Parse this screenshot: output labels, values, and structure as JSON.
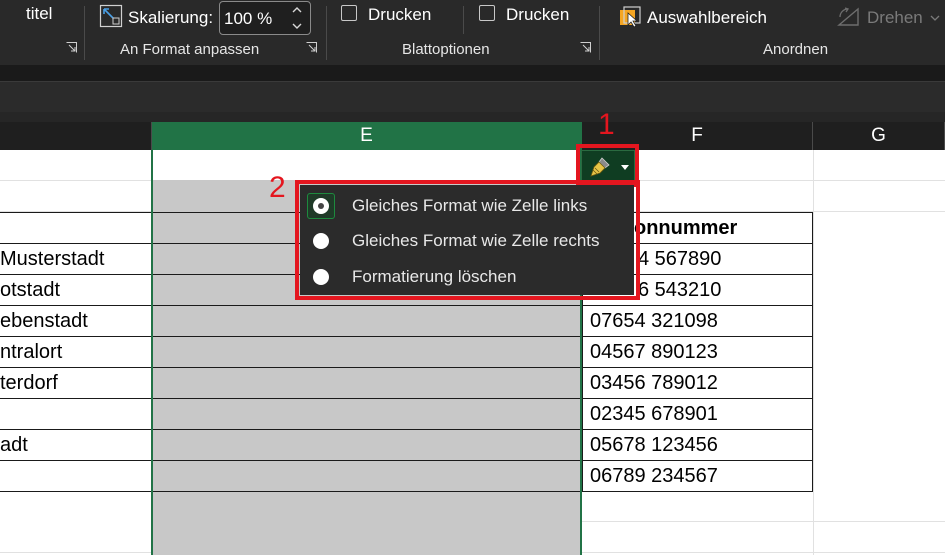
{
  "ribbon": {
    "title_fragment": "titel",
    "scale_label": "Skalierung:",
    "scale_value": "100 %",
    "group_fit": "An Format anpassen",
    "print_gridlines": "Drucken",
    "print_headings": "Drucken",
    "group_sheet_options": "Blattoptionen",
    "selection_pane": "Auswahlbereich",
    "rotate": "Drehen",
    "group_arrange": "Anordnen"
  },
  "columns": {
    "e": "E",
    "f": "F",
    "g": "G"
  },
  "column_a_values": [
    "Musterstadt",
    "otstadt",
    "ebenstadt",
    "ntralort",
    "terdorf",
    "",
    "adt",
    ""
  ],
  "column_f": {
    "header": "onnummer",
    "values": [
      "4 567890",
      "6 543210",
      "07654 321098",
      "04567 890123",
      "03456 789012",
      "02345 678901",
      "05678 123456",
      "06789 234567"
    ]
  },
  "callouts": {
    "one": "1",
    "two": "2"
  },
  "paste_menu": {
    "items": [
      {
        "label": "Gleiches Format wie Zelle links",
        "checked": true
      },
      {
        "label": "Gleiches Format wie Zelle rechts",
        "checked": false
      },
      {
        "label": "Formatierung löschen",
        "checked": false
      }
    ]
  },
  "colors": {
    "selected_header": "#217346",
    "callout_red": "#e4161f",
    "menu_bg": "#2b2b2b",
    "gray_fill": "#c8c8c8"
  }
}
